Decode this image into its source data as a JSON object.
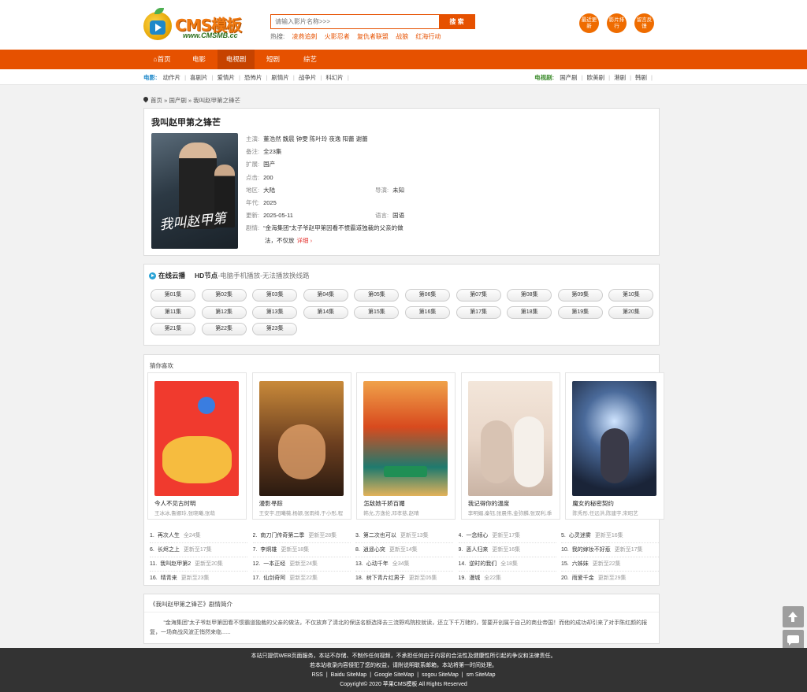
{
  "logo": {
    "brand": "CMS模板",
    "domain": "www.CMSMB.cc"
  },
  "search": {
    "placeholder": "请输入影片名称>>>",
    "button": "搜 索"
  },
  "hot": {
    "label": "热搜:",
    "keywords": [
      "凌燕追刺",
      "火影忍者",
      "复仇者联盟",
      "战狼",
      "红海行动"
    ]
  },
  "circles": [
    "最近更新",
    "影片排行",
    "留言反馈"
  ],
  "nav": [
    "首页",
    "电影",
    "电视剧",
    "短剧",
    "综艺"
  ],
  "nav_active": 2,
  "subnav": {
    "movie_label": "电影:",
    "movie": [
      "动作片",
      "喜剧片",
      "爱情片",
      "恐怖片",
      "剧情片",
      "战争片",
      "科幻片"
    ],
    "tv_label": "电视剧:",
    "tv": [
      "国产剧",
      "欧美剧",
      "港剧",
      "韩剧"
    ]
  },
  "breadcrumb": "首页 » 国产剧 » 我叫赵甲第之锋芒",
  "detail": {
    "title": "我叫赵甲第之锋芒",
    "rows": [
      {
        "k": "主演:",
        "v": "董浩然 魏晨 钟雯 陈叶玲 夜逸 阳蕾 谢蕾"
      },
      {
        "k": "备注:",
        "v": "全23集"
      },
      {
        "k": "扩展:",
        "v": "国产"
      },
      {
        "k": "点击:",
        "v": "200"
      },
      {
        "k": "地区:",
        "v": "大陆"
      },
      {
        "k": "年代:",
        "v": "2025"
      },
      {
        "k": "更新:",
        "v": "2025-05-11"
      },
      {
        "k": "剧情:",
        "v": "“金海集团”太子爷赵甲第因看不惯霸道独裁的父亲的做"
      }
    ],
    "director_k": "导演:",
    "director_v": "未知",
    "lang_k": "语言:",
    "lang_v": "国语",
    "plot_line2": "法，不仅放",
    "more": "详细 ›",
    "poster_calligraphy": "我叫赵甲第"
  },
  "play": {
    "title": "在线云播",
    "source": "HD节点",
    "source_desc": "-电脑手机播放-无法播放换线路",
    "episodes": [
      "第01集",
      "第02集",
      "第03集",
      "第04集",
      "第05集",
      "第06集",
      "第07集",
      "第08集",
      "第09集",
      "第10集",
      "第11集",
      "第12集",
      "第13集",
      "第14集",
      "第15集",
      "第16集",
      "第17集",
      "第18集",
      "第19集",
      "第20集",
      "第21集",
      "第22集",
      "第23集"
    ]
  },
  "like": {
    "title": "猜你喜欢",
    "cards": [
      {
        "title": "今人不见古时明",
        "actors": "王冰冰,鲁娜玲,张晓曦,张萌"
      },
      {
        "title": "漫影寻踪",
        "actors": "王安宇,田曦薇,杨颖,张雨绮,于小彤,程"
      },
      {
        "title": "怎敌她千娇百媚",
        "actors": "韩允,方逸伦,邓孝慈,赵晴"
      },
      {
        "title": "我记得你的温度",
        "actors": "李明媚,秦钰,张晨伟,金弥麟,张双利,季"
      },
      {
        "title": "魔女的秘密契约",
        "actors": "陈秀彤,任远洪,陈建宇,宋昭艺"
      }
    ],
    "rank": [
      {
        "n": "1.",
        "name": "再次人生",
        "status": "全24集"
      },
      {
        "n": "2.",
        "name": "南刀门传奇第二季",
        "status": "更新至28集"
      },
      {
        "n": "3.",
        "name": "第二次也可以",
        "status": "更新至13集"
      },
      {
        "n": "4.",
        "name": "一念倾心",
        "status": "更新至17集"
      },
      {
        "n": "5.",
        "name": "心灵迷雾",
        "status": "更新至16集"
      },
      {
        "n": "6.",
        "name": "长烬之上",
        "status": "更新至17集"
      },
      {
        "n": "7.",
        "name": "李炯雄",
        "status": "更新至18集"
      },
      {
        "n": "8.",
        "name": "逍遥心突",
        "status": "更新至14集"
      },
      {
        "n": "9.",
        "name": "恶人归来",
        "status": "更新至16集"
      },
      {
        "n": "10.",
        "name": "我的嫁妆不好惹",
        "status": "更新至17集"
      },
      {
        "n": "11.",
        "name": "我叫赵甲第2",
        "status": "更新至20集"
      },
      {
        "n": "12.",
        "name": "一本正经",
        "status": "更新至24集"
      },
      {
        "n": "13.",
        "name": "心动千年",
        "status": "全34集"
      },
      {
        "n": "14.",
        "name": "逆时的我们",
        "status": "全18集"
      },
      {
        "n": "15.",
        "name": "六姊妹",
        "status": "更新至22集"
      },
      {
        "n": "16.",
        "name": "晴青来",
        "status": "更新至23集"
      },
      {
        "n": "17.",
        "name": "仙剑奇阿",
        "status": "更新至22集"
      },
      {
        "n": "18.",
        "name": "树下青片红男子",
        "status": "更新至05集"
      },
      {
        "n": "19.",
        "name": "漫城",
        "status": "全22集"
      },
      {
        "n": "20.",
        "name": "雨爱千金",
        "status": "更新至29集"
      }
    ]
  },
  "intro": {
    "title": "《我叫赵甲第之锋芒》剧情简介",
    "text": "“金海集团”太子爷赵甲第因看不惯霸道独裁的父亲的做法，不仅放弃了清北的保送名额选择去三流野鸡院校就读，还立下千万赌约，誓要开创属于自己的商业帝国！而他的成功却引来了对手陈红颜的报复，一场商战风波正悄然来临......"
  },
  "footer": {
    "line1": "本站只提供WEB页面服务，本站不存储、不制作任何视频，不承担任何由于内容的合法性及健康性所引起的争议和法律责任。",
    "line2": "若本站收录内容侵犯了您的权益，请附说明联系邮箱，本站将第一时间处理。",
    "links": [
      "RSS",
      "Baidu SiteMap",
      "Google SiteMap",
      "sogou SiteMap",
      "sm SiteMap"
    ],
    "copyright": "Copyright© 2020 苹果CMS模板 All Rights Reserved"
  }
}
